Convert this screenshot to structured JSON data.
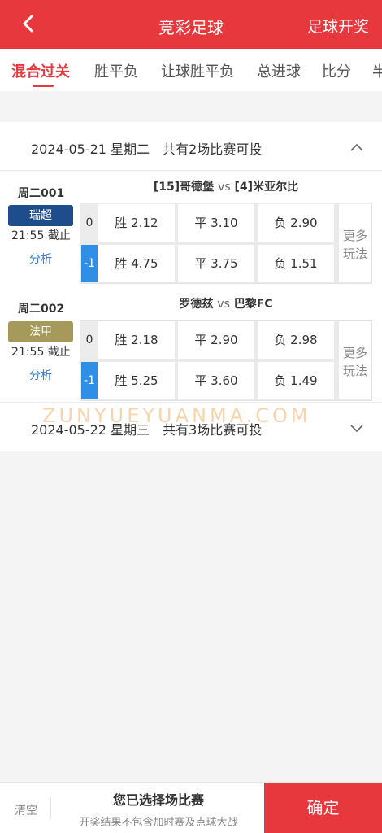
{
  "header": {
    "title": "竞彩足球",
    "right_link": "足球开奖"
  },
  "tabs": [
    "混合过关",
    "胜平负",
    "让球胜平负",
    "总进球",
    "比分",
    "半"
  ],
  "colors": {
    "brand": "#e7383e",
    "link": "#3a7fd5",
    "handicap_negative": "#2f8ee5",
    "league_swiss": "#1e4d8c",
    "league_french": "#a69a5a"
  },
  "sections": [
    {
      "date_text": "2024-05-21 星期二　共有2场比赛可投",
      "expanded": true
    },
    {
      "date_text": "2024-05-22 星期三　共有3场比赛可投",
      "expanded": false
    }
  ],
  "matches": [
    {
      "no": "周二001",
      "league": "瑞超",
      "deadline": "21:55 截止",
      "analysis": "分析",
      "home": "[15]哥德堡",
      "vs": "vs",
      "away": "[4]米亚尔比",
      "rows": [
        {
          "handicap": "0",
          "win": "胜 2.12",
          "draw": "平 3.10",
          "lose": "负 2.90"
        },
        {
          "handicap": "-1",
          "win": "胜 4.75",
          "draw": "平 3.75",
          "lose": "负 1.51"
        }
      ],
      "more": "更多玩法"
    },
    {
      "no": "周二002",
      "league": "法甲",
      "deadline": "21:55 截止",
      "analysis": "分析",
      "home": "罗德兹",
      "vs": "vs",
      "away": "巴黎FC",
      "rows": [
        {
          "handicap": "0",
          "win": "胜 2.18",
          "draw": "平 2.90",
          "lose": "负 2.98"
        },
        {
          "handicap": "-1",
          "win": "胜 5.25",
          "draw": "平 3.60",
          "lose": "负 1.49"
        }
      ],
      "more": "更多玩法"
    }
  ],
  "watermark": "ZUNYUEYUANMA.COM",
  "footer": {
    "clear": "清空",
    "selected": "您已选择场比赛",
    "note": "开奖结果不包含加时赛及点球大战",
    "confirm": "确定"
  }
}
